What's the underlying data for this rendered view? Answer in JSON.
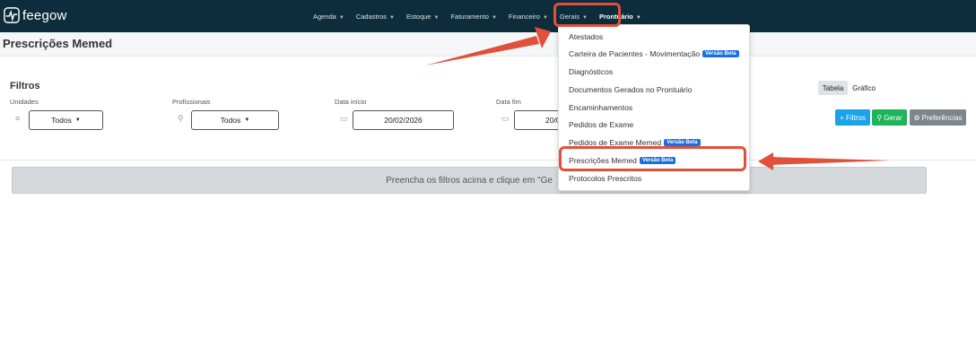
{
  "app": {
    "logo_text": "feegow"
  },
  "nav": {
    "items": [
      {
        "label": "Agenda"
      },
      {
        "label": "Cadastros"
      },
      {
        "label": "Estoque"
      },
      {
        "label": "Faturamento"
      },
      {
        "label": "Financeiro"
      },
      {
        "label": "Gerais"
      },
      {
        "label": "Prontuário",
        "active": true
      }
    ]
  },
  "page": {
    "title": "Prescrições Memed"
  },
  "filters": {
    "title": "Filtros",
    "unidades": {
      "label": "Unidades",
      "value": "Todos"
    },
    "profissionais": {
      "label": "Profissionais",
      "value": "Todos"
    },
    "data_inicio": {
      "label": "Data início",
      "value": "20/02/2026"
    },
    "data_fim": {
      "label": "Data fim",
      "value": "20/0"
    }
  },
  "view": {
    "tabela": "Tabela",
    "grafico": "Gráfico"
  },
  "buttons": {
    "filtros": "+ Filtros",
    "gerar": "Gerar",
    "preferencias": "Preferências"
  },
  "notice": "Preencha os filtros acima e clique em \"Ge",
  "dropdown": {
    "items": [
      {
        "label": "Atestados"
      },
      {
        "label": "Carteira de Pacientes - Movimentação",
        "badge": "Versão Beta"
      },
      {
        "label": "Diagnósticos"
      },
      {
        "label": "Documentos Gerados no Prontuário"
      },
      {
        "label": "Encaminhamentos"
      },
      {
        "label": "Pedidos de Exame"
      },
      {
        "label": "Pedidos de Exame Memed",
        "badge": "Versão Beta"
      },
      {
        "label": "Prescrições Memed",
        "badge": "Versão Beta"
      },
      {
        "label": "Protocolos Prescritos"
      }
    ]
  },
  "colors": {
    "navbar": "#0d2d3c",
    "highlight": "#e0503a",
    "badge": "#1a6fe0"
  }
}
